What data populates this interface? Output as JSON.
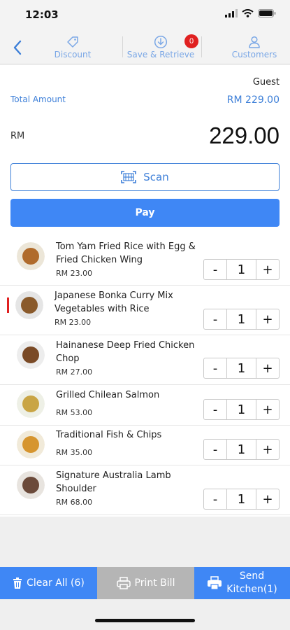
{
  "status": {
    "time": "12:03"
  },
  "toolbar": {
    "discount_label": "Discount",
    "save_retrieve_label": "Save & Retrieve",
    "save_retrieve_badge": "0",
    "customers_label": "Customers"
  },
  "summary": {
    "customer": "Guest",
    "total_label": "Total Amount",
    "total_value": "RM 229.00",
    "currency": "RM",
    "amount": "229.00"
  },
  "actions": {
    "scan_label": "Scan",
    "pay_label": "Pay"
  },
  "items": [
    {
      "name": "Tom Yam Fried Rice with Egg & Fried Chicken Wing",
      "price": "RM 23.00",
      "qty": "1",
      "thumb_color": "#b06b2c"
    },
    {
      "name": "Japanese Bonka Curry Mix Vegetables with Rice",
      "price": "RM 23.00",
      "qty": "1",
      "thumb_color": "#8a5a2b"
    },
    {
      "name": "Hainanese Deep Fried Chicken Chop",
      "price": "RM 27.00",
      "qty": "1",
      "thumb_color": "#7a4a26"
    },
    {
      "name": "Grilled Chilean Salmon",
      "price": "RM 53.00",
      "qty": "1",
      "thumb_color": "#c9a545"
    },
    {
      "name": "Traditional Fish & Chips",
      "price": "RM 35.00",
      "qty": "1",
      "thumb_color": "#d6952f"
    },
    {
      "name": "Signature Australia Lamb Shoulder",
      "price": "RM 68.00",
      "qty": "1",
      "thumb_color": "#6b4a3a"
    }
  ],
  "stepper_labels": {
    "minus": "-",
    "plus": "+"
  },
  "bottom": {
    "clear_label": "Clear All (6)",
    "print_label": "Print Bill",
    "send_line1": "Send",
    "send_line2": "Kitchen(1)"
  },
  "colors": {
    "accent": "#3f87f5",
    "accent_text": "#3d7fd8",
    "badge": "#e02020",
    "disabled": "#b5b5b5"
  }
}
